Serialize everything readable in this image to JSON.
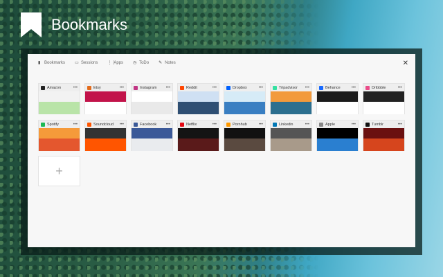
{
  "app": {
    "title": "Bookmarks"
  },
  "nav": [
    {
      "label": "Bookmarks",
      "icon": "bookmark-icon"
    },
    {
      "label": "Sessions",
      "icon": "window-icon"
    },
    {
      "label": "Apps",
      "icon": "grid-icon"
    },
    {
      "label": "ToDo",
      "icon": "check-circle-icon"
    },
    {
      "label": "Notes",
      "icon": "pencil-icon"
    }
  ],
  "bookmarks": [
    {
      "name": "Amazon",
      "color": "#222222",
      "thumb": [
        "#f2f2f2",
        "#b9e4a8"
      ]
    },
    {
      "name": "Etsy",
      "color": "#e36b1c",
      "thumb": [
        "#c2134a",
        "#ffffff"
      ]
    },
    {
      "name": "Instagram",
      "color": "#c13584",
      "thumb": [
        "#ffffff",
        "#e9e9e9"
      ]
    },
    {
      "name": "Reddit",
      "color": "#ff4500",
      "thumb": [
        "#cfe0f3",
        "#2f4f73"
      ]
    },
    {
      "name": "Dropbox",
      "color": "#0061fe",
      "thumb": [
        "#d6ebf7",
        "#3a7fc2"
      ]
    },
    {
      "name": "Tripadvisor",
      "color": "#34e0a1",
      "thumb": [
        "#f29a3c",
        "#2c6f8f"
      ]
    },
    {
      "name": "Behance",
      "color": "#1769ff",
      "thumb": [
        "#1a1a1a",
        "#ffffff"
      ]
    },
    {
      "name": "Dribbble",
      "color": "#ea4c89",
      "thumb": [
        "#222222",
        "#ffffff"
      ]
    },
    {
      "name": "Spotify",
      "color": "#1db954",
      "thumb": [
        "#f59a3a",
        "#e4572e"
      ]
    },
    {
      "name": "Soundcloud",
      "color": "#ff5500",
      "thumb": [
        "#333333",
        "#ff5500"
      ]
    },
    {
      "name": "Facebook",
      "color": "#3b5998",
      "thumb": [
        "#3b5998",
        "#e9ebee"
      ]
    },
    {
      "name": "Netflix",
      "color": "#e50914",
      "thumb": [
        "#141414",
        "#5a1a1a"
      ]
    },
    {
      "name": "Pornhub",
      "color": "#ff9900",
      "thumb": [
        "#111111",
        "#5a4a40"
      ]
    },
    {
      "name": "Linkedin",
      "color": "#0077b5",
      "thumb": [
        "#555555",
        "#a89a8a"
      ]
    },
    {
      "name": "Apple",
      "color": "#888888",
      "thumb": [
        "#000000",
        "#2a7fd0"
      ]
    },
    {
      "name": "Tumblr",
      "color": "#111111",
      "thumb": [
        "#6a1010",
        "#d6451d"
      ]
    }
  ],
  "more_label": "•••",
  "add_label": "+",
  "close_label": "✕"
}
